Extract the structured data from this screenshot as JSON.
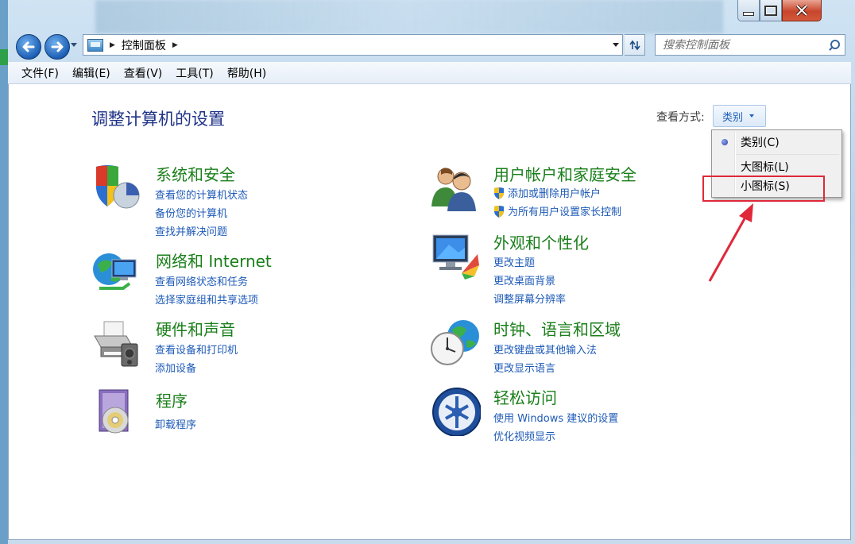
{
  "window": {
    "breadcrumb": "控制面板",
    "search_placeholder": "搜索控制面板"
  },
  "menubar": [
    "文件(F)",
    "编辑(E)",
    "查看(V)",
    "工具(T)",
    "帮助(H)"
  ],
  "page": {
    "title": "调整计算机的设置",
    "view_label": "查看方式:",
    "view_value": "类别"
  },
  "view_menu": {
    "items": [
      "类别(C)",
      "大图标(L)",
      "小图标(S)"
    ],
    "selected": "类别(C)",
    "highlighted": "小图标(S)",
    "highlight_color": "#e0283a"
  },
  "categories": [
    {
      "title": "系统和安全",
      "icon": "system-security-icon",
      "links": [
        "查看您的计算机状态",
        "备份您的计算机",
        "查找并解决问题"
      ]
    },
    {
      "title": "网络和 Internet",
      "icon": "network-icon",
      "links": [
        "查看网络状态和任务",
        "选择家庭组和共享选项"
      ]
    },
    {
      "title": "硬件和声音",
      "icon": "printer-icon",
      "links": [
        "查看设备和打印机",
        "添加设备"
      ]
    },
    {
      "title": "程序",
      "icon": "programs-icon",
      "links": [
        "卸载程序"
      ]
    },
    {
      "title": "用户帐户和家庭安全",
      "icon": "users-icon",
      "links": [
        "添加或删除用户帐户",
        "为所有用户设置家长控制"
      ]
    },
    {
      "title": "外观和个性化",
      "icon": "monitor-paint-icon",
      "links": [
        "更改主题",
        "更改桌面背景",
        "调整屏幕分辨率"
      ]
    },
    {
      "title": "时钟、语言和区域",
      "icon": "clock-globe-icon",
      "links": [
        "更改键盘或其他输入法",
        "更改显示语言"
      ]
    },
    {
      "title": "轻松访问",
      "icon": "ease-of-access-icon",
      "links": [
        "使用 Windows 建议的设置",
        "优化视频显示"
      ]
    }
  ],
  "colors": {
    "title_blue": "#1e3287",
    "category_green": "#1a7f1a",
    "link_blue": "#1d5ab7"
  }
}
